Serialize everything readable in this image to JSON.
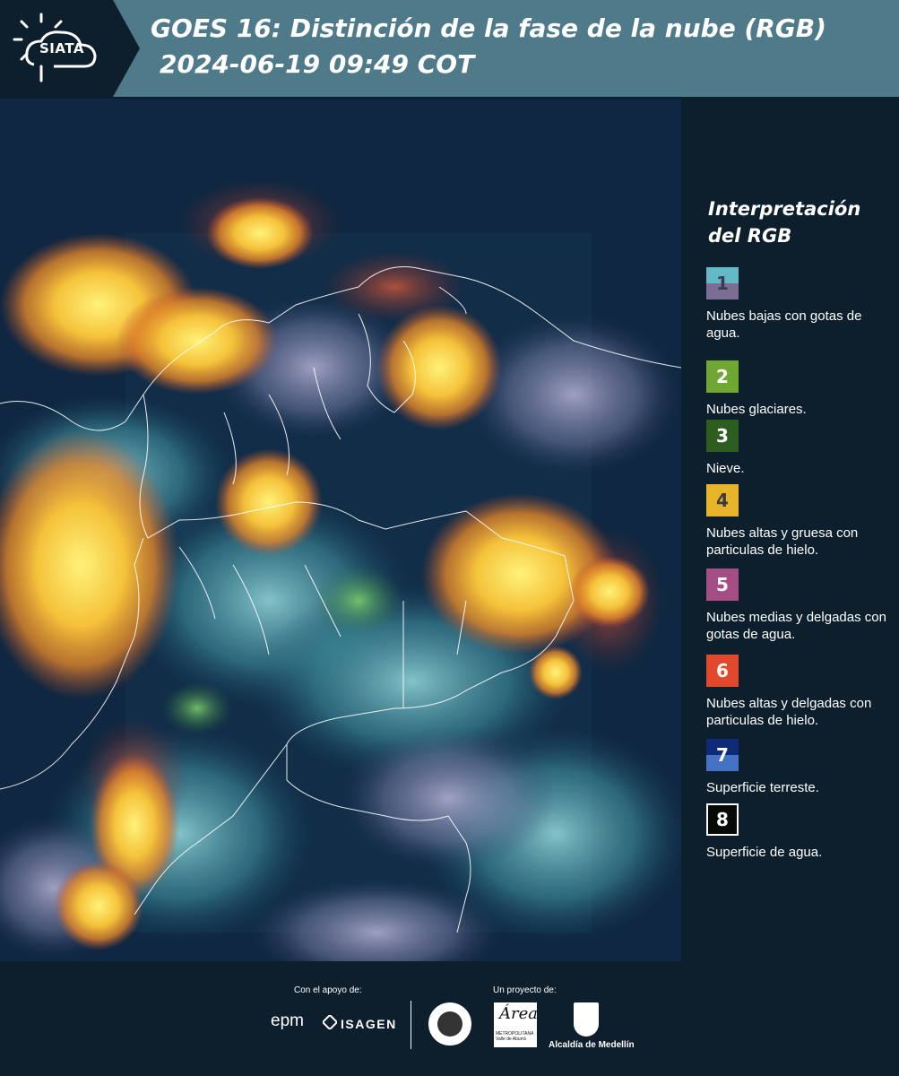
{
  "header": {
    "logo_text": "SIATA",
    "title": "GOES 16: Distinción de la fase de la nube (RGB)",
    "subtitle": "2024-06-19 09:49 COT"
  },
  "legend": {
    "title": "Interpretación del RGB",
    "items": [
      {
        "number": "1",
        "label": "Nubes bajas con gotas de agua.",
        "color_top": "#63b9c6",
        "color_bottom": "#7a6f92",
        "num_color": "#3b3b55"
      },
      {
        "number": "2",
        "label": "Nubes glaciares.",
        "color_top": "#6fa733",
        "num_color": "#ffffff"
      },
      {
        "number": "3",
        "label": "Nieve.",
        "color_top": "#2e5e1f",
        "num_color": "#ffffff"
      },
      {
        "number": "4",
        "label": "Nubes altas y gruesa con particulas de hielo.",
        "color_top": "#e8b52a",
        "num_color": "#3b3b3b"
      },
      {
        "number": "5",
        "label": "Nubes medias y delgadas con gotas de agua.",
        "color_top": "#a54e86",
        "num_color": "#ffffff"
      },
      {
        "number": "6",
        "label": "Nubes altas y delgadas con particulas de hielo.",
        "color_top": "#e2482b",
        "num_color": "#ffffff"
      },
      {
        "number": "7",
        "label": "Superficie terreste.",
        "color_top": "#0f2a78",
        "color_bottom": "#4472c4",
        "num_color": "#ffffff"
      },
      {
        "number": "8",
        "label": "Superficie de agua.",
        "color_top": "#050a08",
        "num_color": "#ffffff",
        "border": "#ffffff"
      }
    ]
  },
  "footer": {
    "support_caption": "Con el apoyo de:",
    "project_caption": "Un proyecto de:",
    "epm": "epm",
    "isagen": "ISAGEN",
    "area_a": "Área",
    "area_small": "METROPOLITANA Valle de Aburrá",
    "alcaldia": "Alcaldía de Medellín"
  }
}
